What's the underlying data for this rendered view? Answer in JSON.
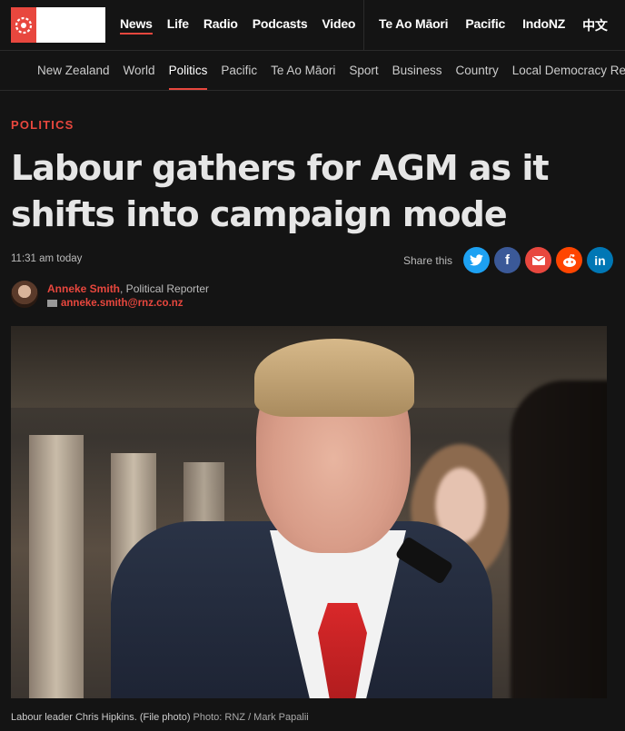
{
  "primary_nav": [
    "News",
    "Life",
    "Radio",
    "Podcasts",
    "Video"
  ],
  "language_nav": [
    "Te Ao Māori",
    "Pacific",
    "IndoNZ",
    "中文"
  ],
  "sub_nav": [
    "New Zealand",
    "World",
    "Politics",
    "Pacific",
    "Te Ao Māori",
    "Sport",
    "Business",
    "Country",
    "Local Democracy Reporting"
  ],
  "article": {
    "section": "POLITICS",
    "headline": "Labour gathers for AGM as it shifts into campaign mode",
    "timestamp": "11:31 am today",
    "share_label": "Share this",
    "author_name": "Anneke Smith",
    "author_role": ", Political Reporter",
    "author_email": "anneke.smith@rnz.co.nz",
    "caption": "Labour leader Chris Hipkins. (File photo)",
    "caption_credit": "Photo: RNZ / Mark Papalii"
  },
  "share_buttons": [
    {
      "name": "twitter-share-button",
      "glyph": "🐦",
      "color": "#1da1f2"
    },
    {
      "name": "facebook-share-button",
      "glyph": "f",
      "color": "#3b5998"
    },
    {
      "name": "email-share-button",
      "glyph": "✉",
      "color": "#e8473e"
    },
    {
      "name": "reddit-share-button",
      "glyph": "👽",
      "color": "#ff4500"
    },
    {
      "name": "linkedin-share-button",
      "glyph": "in",
      "color": "#0077b5"
    }
  ],
  "colors": {
    "accent": "#e8473e",
    "background": "#141414"
  }
}
